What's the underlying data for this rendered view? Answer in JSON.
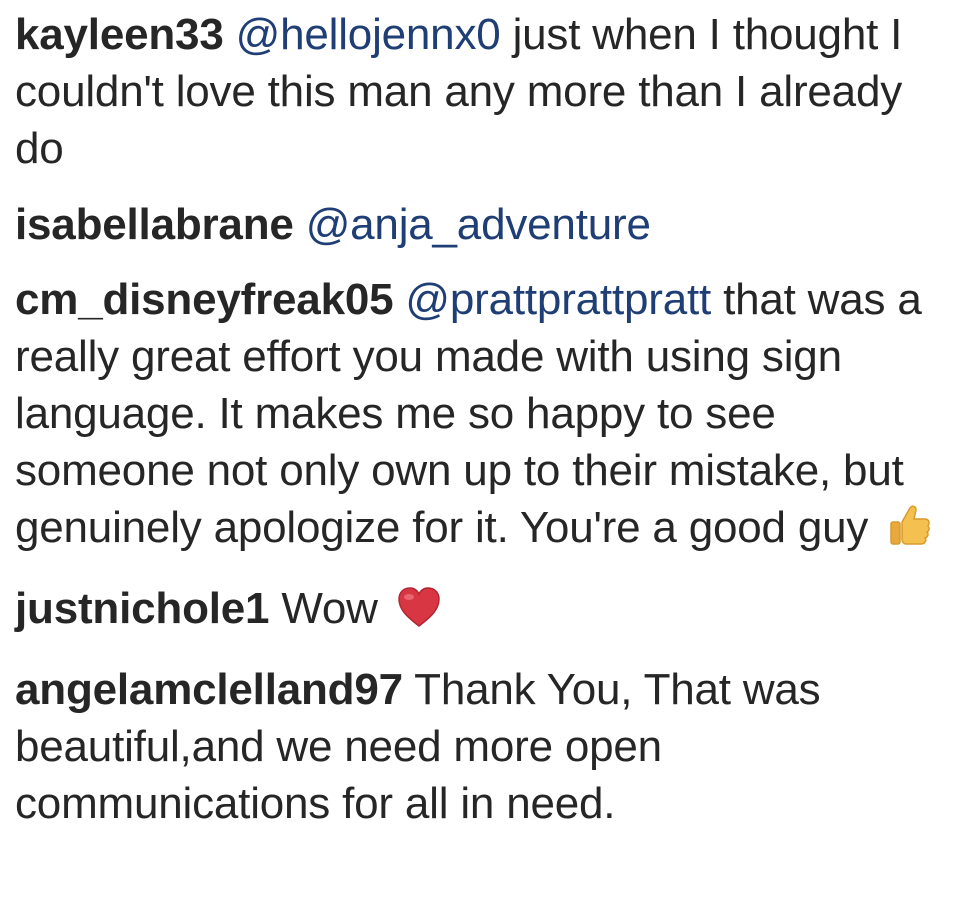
{
  "comments": [
    {
      "username": "kayleen33",
      "mention": "@hellojennx0",
      "text": "just when I thought I couldn't love this man any more than I already do"
    },
    {
      "username": "isabellabrane",
      "mention": "@anja_adventure",
      "text": ""
    },
    {
      "username": "cm_disneyfreak05",
      "mention": "@prattprattpratt",
      "text": "that was a really great effort you made with using sign language. It makes me so happy to see someone not only own up to their mistake, but genuinely apologize for it. You're a good guy",
      "emoji": "thumbs-up-icon"
    },
    {
      "username": "justnichole1",
      "text": "Wow",
      "emoji": "red-heart-icon"
    },
    {
      "username": "angelamclelland97",
      "text": "Thank You, That was beautiful,and we need more open communications for all in need."
    }
  ],
  "colors": {
    "text": "#262626",
    "mention": "#1e3e75",
    "heart": "#d93643",
    "thumb": "#f4c150"
  }
}
